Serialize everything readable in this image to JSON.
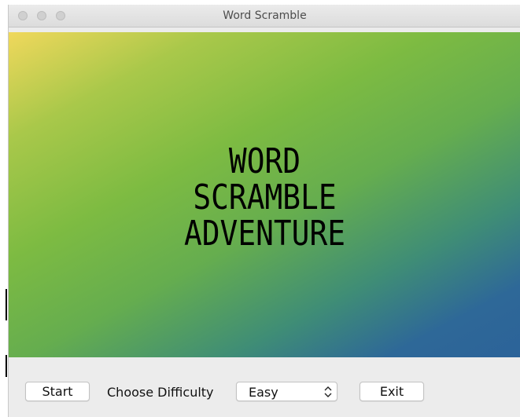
{
  "window": {
    "title": "Word Scramble"
  },
  "banner": {
    "headline_lines": [
      "WORD",
      "SCRAMBLE",
      "ADVENTURE"
    ],
    "gradient_colors": [
      "#f0d85c",
      "#7dbb42",
      "#2c6399"
    ]
  },
  "controls": {
    "start_label": "Start",
    "difficulty_label": "Choose Difficulty",
    "difficulty_selected": "Easy",
    "exit_label": "Exit"
  },
  "icons": {
    "traffic_lights": [
      "close-icon",
      "minimize-icon",
      "zoom-icon"
    ],
    "select_arrows": "up-down-chevron-icon"
  }
}
